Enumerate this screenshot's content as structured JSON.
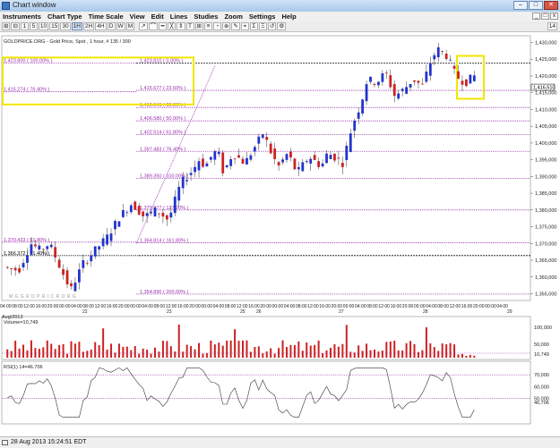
{
  "window": {
    "title": "Chart window",
    "btn_min": "–",
    "btn_max": "□",
    "btn_close": "✕"
  },
  "menu": [
    "Instruments",
    "Chart Type",
    "Time Scale",
    "View",
    "Edit",
    "Lines",
    "Studies",
    "Zoom",
    "Settings",
    "Help"
  ],
  "mdi_buttons": [
    "_",
    "□",
    "x"
  ],
  "toolbar": {
    "buttons": [
      "⊞",
      "⊟",
      "1",
      "5",
      "10",
      "15",
      "30",
      "1H",
      "2H",
      "4H",
      "D",
      "W",
      "M",
      "|",
      "↗",
      "⌒",
      "━",
      "╳",
      "⇕",
      "T",
      "⊞",
      "≡",
      "◔",
      "⊕",
      "✎",
      "⌖",
      "Σ",
      "Ξ",
      "↺",
      "⚙"
    ],
    "active_index": 7,
    "page_badge": "14"
  },
  "chart": {
    "header": "GOLDPRICE.ORG - Gold Price, Spot , 1 hour, # 135 / 300",
    "price_axis_labels": [
      "1,430,000",
      "1,425,000",
      "1,420,000",
      "1,415,000",
      "1,410,000",
      "1,405,000",
      "1,400,000",
      "1,395,000",
      "1,390,000",
      "1,385,000",
      "1,380,000",
      "1,375,000",
      "1,370,000",
      "1,365,000",
      "1,360,000",
      "1,355,000"
    ],
    "current_price_label": "1,416,510",
    "fib_labels": [
      "1,433.183 ( -27.20% )",
      "1,423.810 ( 0.00% )",
      "1,415.677 ( 23.60% )",
      "1,410.646 ( 38.20% )",
      "1,406.580 ( 50.00% )",
      "1,402.514 ( 61.80% )",
      "1,397.483 ( 76.40% )",
      "1,389.350 ( 100.00% )",
      "1,379.977 ( 127.20% )",
      "1,364.814 ( 161.80% )",
      "1,354.890 ( 200.00% )"
    ],
    "left_fib_labels": [
      "1,423.800 ( 100.00% )",
      "1,415.274 ( 76.40% )",
      "1,370.433 ( 61.80% )",
      "1,366.372 ( 51.40% )"
    ],
    "watermark": "Μ  G  G  R  D  P  R  I  C  R  Ο  R  G",
    "time_labels": [
      "04:00",
      "08:00",
      "12:00",
      "16:00",
      "20:00",
      "00:00",
      "04:00",
      "08:00",
      "12:00",
      "16:00",
      "20:00",
      "00:00",
      "04:00",
      "08:00",
      "12:00",
      "16:00",
      "20:00",
      "00:00",
      "04:00",
      "08:00",
      "12:00",
      "16:00",
      "20:00",
      "00:00",
      "04:00",
      "08:00",
      "12:00",
      "16:00",
      "20:00",
      "00:00",
      "04:00",
      "08:00",
      "12:00",
      "16:00",
      "20:00",
      "00:00",
      "04:00",
      "08:00",
      "12:00",
      "16:00",
      "20:00",
      "00:00",
      "04:00"
    ],
    "date_labels": [
      "22",
      "23",
      "25",
      "26",
      "27",
      "28",
      "29"
    ],
    "month_label": "Aug/2013"
  },
  "volume": {
    "title": "Volume=10,749",
    "axis_labels": [
      "100,000",
      "50,000",
      "10,749"
    ]
  },
  "rsi": {
    "title": "RSI(1) 14=46.706",
    "axis_labels": [
      "70,000",
      "60,000",
      "50,000",
      "46,706"
    ]
  },
  "status": {
    "text": "28 Aug 2013 15:24:51 EDT"
  },
  "colors": {
    "up": "#2233cc",
    "down": "#cc2222",
    "fib": "#9b2fae",
    "highlight": "#f2e600",
    "grid": "#e4e4e4"
  }
}
